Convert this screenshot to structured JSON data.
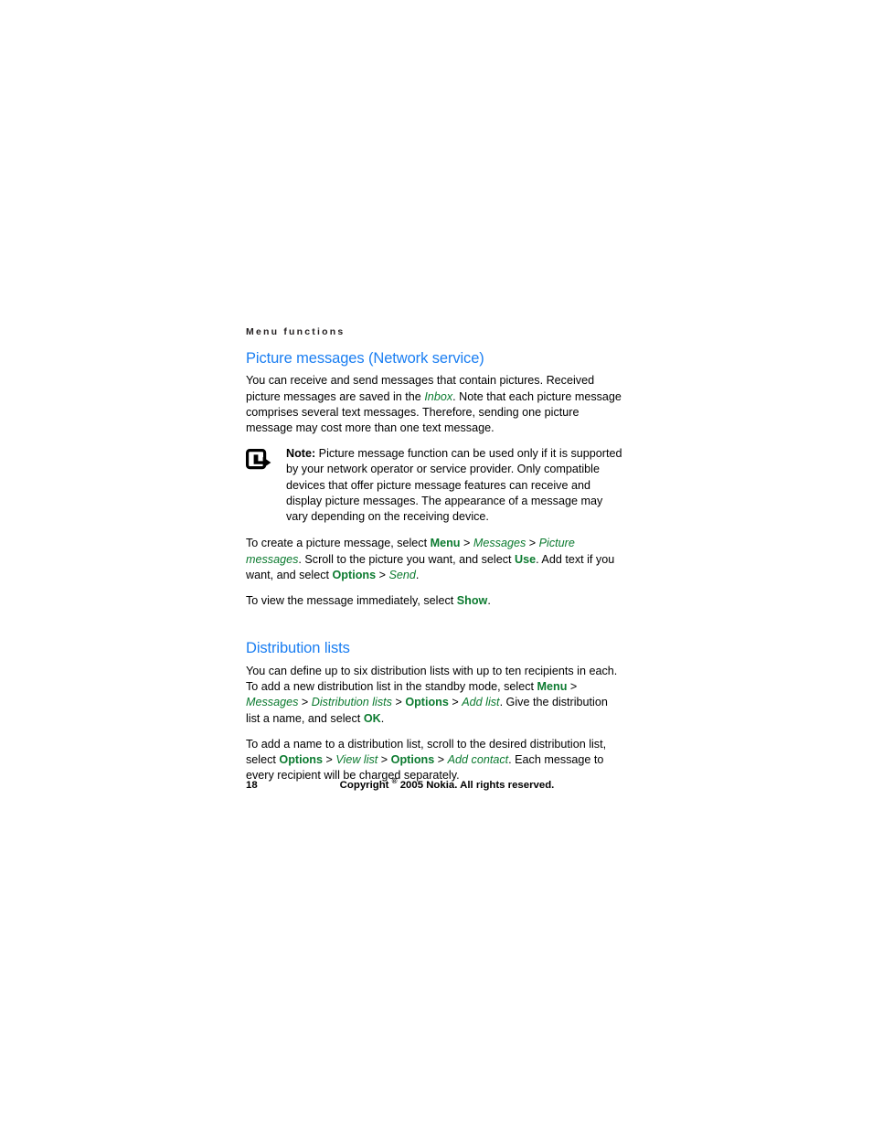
{
  "document": {
    "running_head": "Menu functions",
    "page_number": "18",
    "copyright_prefix": "Copyright ",
    "copyright_mark": "®",
    "copyright_suffix": " 2005 Nokia. All rights reserved."
  },
  "colors": {
    "heading_blue": "#1a7ef2",
    "ui_green": "#0b7a2f",
    "body_black": "#000000",
    "running_head": "#231f20"
  },
  "sections": [
    {
      "heading": "Picture messages (Network service)",
      "paragraph_1": {
        "part_1": "You can receive and send messages that contain pictures. Received picture messages are saved in the ",
        "ui_italic_1": "Inbox",
        "part_2": ". Note that each picture message comprises several text messages. Therefore, sending one picture message may cost more than one text message."
      },
      "note": {
        "icon": "note-arrow-icon",
        "label": "Note:",
        "text": " Picture message function can be used only if it is supported by your network operator or service provider. Only compatible devices that offer picture message features can receive and display picture messages. The appearance of a message may vary depending on the receiving device."
      },
      "paragraph_2": {
        "part_1": "To create a picture message, select ",
        "ui_bold_1": "Menu",
        "sep_1": " > ",
        "ui_italic_1": "Messages",
        "sep_2": " > ",
        "ui_italic_2": "Picture messages",
        "part_2": ". Scroll to the picture you want, and select ",
        "ui_bold_2": "Use",
        "part_3": ". Add text if you want, and select ",
        "ui_bold_3": "Options",
        "sep_3": " > ",
        "ui_italic_3": "Send",
        "part_4": "."
      },
      "paragraph_3": {
        "part_1": "To view the message immediately, select ",
        "ui_bold_1": "Show",
        "part_2": "."
      }
    },
    {
      "heading": "Distribution lists",
      "paragraph_1": {
        "part_1": "You can define up to six distribution lists with up to ten recipients in each. To add a new distribution list in the standby mode, select ",
        "ui_bold_1": "Menu",
        "sep_1": " > ",
        "ui_italic_1": "Messages",
        "sep_2": " > ",
        "ui_italic_2": "Distribution lists",
        "sep_3": " > ",
        "ui_bold_2": "Options",
        "sep_4": " > ",
        "ui_italic_3": "Add list",
        "part_2": ". Give the distribution list a name, and select ",
        "ui_bold_3": "OK",
        "part_3": "."
      },
      "paragraph_2": {
        "part_1": "To add a name to a distribution list, scroll to the desired distribution list, select ",
        "ui_bold_1": "Options",
        "sep_1": " > ",
        "ui_italic_1": "View list",
        "sep_2": " > ",
        "ui_bold_2": "Options",
        "sep_3": " > ",
        "ui_italic_2": "Add contact",
        "part_2": ". Each message to every recipient will be charged separately."
      }
    }
  ]
}
